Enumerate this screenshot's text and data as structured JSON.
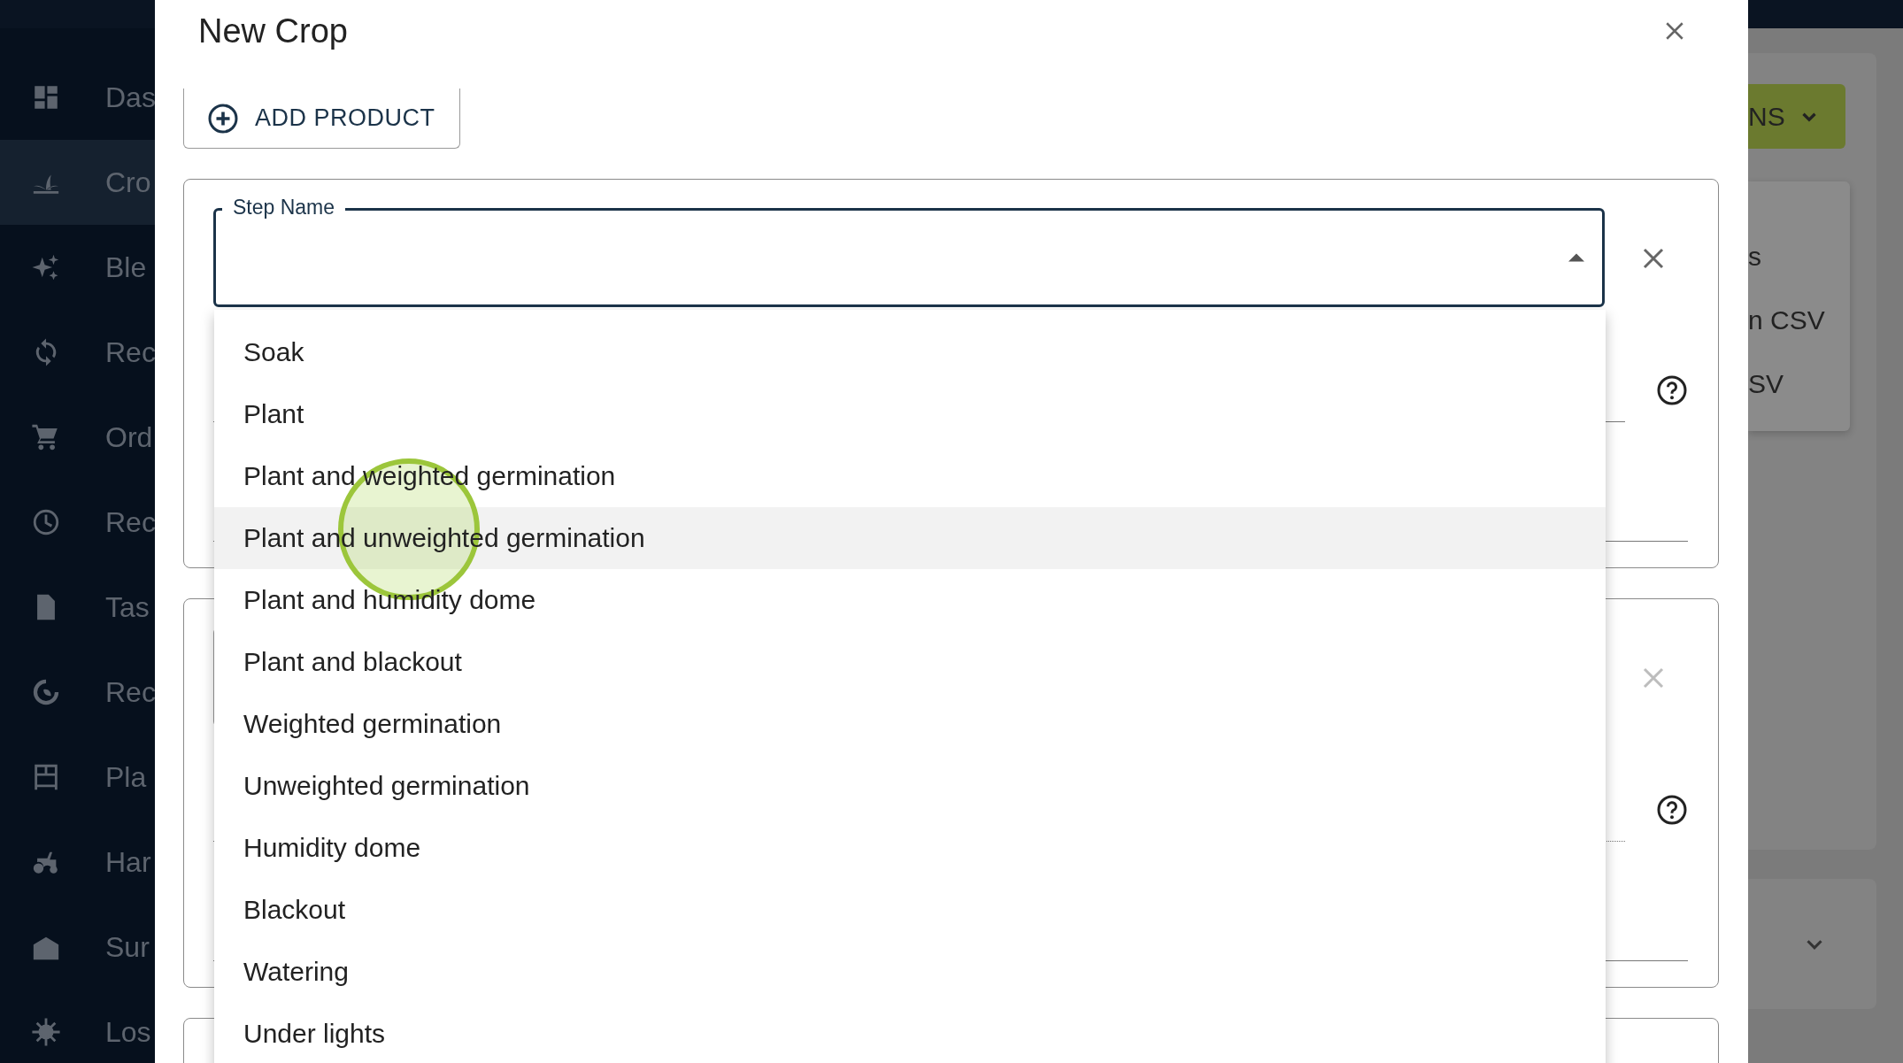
{
  "sidebar": {
    "items": [
      {
        "label": "Das",
        "selected": false
      },
      {
        "label": "Cro",
        "selected": true
      },
      {
        "label": "Ble",
        "selected": false
      },
      {
        "label": "Rec",
        "selected": false
      },
      {
        "label": "Ord",
        "selected": false
      },
      {
        "label": "Rec",
        "selected": false
      },
      {
        "label": "Tas",
        "selected": false
      },
      {
        "label": "Rec",
        "selected": false
      },
      {
        "label": "Pla",
        "selected": false
      },
      {
        "label": "Har",
        "selected": false
      },
      {
        "label": "Sur",
        "selected": false
      },
      {
        "label": "Los",
        "selected": false
      }
    ]
  },
  "dialog": {
    "title": "New Crop",
    "add_product_button": "ADD PRODUCT",
    "step_cards": [
      {
        "field_label": "Step Name",
        "focused": true,
        "disabled": false
      },
      {
        "focused": false,
        "disabled": true
      }
    ],
    "step_name_options": [
      {
        "label": "Soak",
        "hovered": false
      },
      {
        "label": "Plant",
        "hovered": false
      },
      {
        "label": "Plant and weighted germination",
        "hovered": false
      },
      {
        "label": "Plant and unweighted germination",
        "hovered": true
      },
      {
        "label": "Plant and humidity dome",
        "hovered": false
      },
      {
        "label": "Plant and blackout",
        "hovered": false
      },
      {
        "label": "Weighted germination",
        "hovered": false
      },
      {
        "label": "Unweighted germination",
        "hovered": false
      },
      {
        "label": "Humidity dome",
        "hovered": false
      },
      {
        "label": "Blackout",
        "hovered": false
      },
      {
        "label": "Watering",
        "hovered": false
      },
      {
        "label": "Under lights",
        "hovered": false
      }
    ]
  },
  "background": {
    "actions_button": "NS",
    "menu_items": [
      "s",
      "n CSV",
      "SV"
    ]
  }
}
